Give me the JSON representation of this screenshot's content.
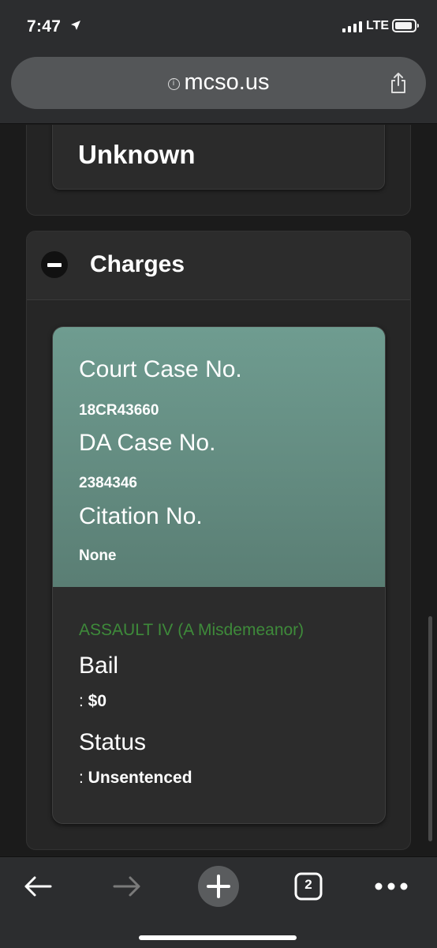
{
  "status_bar": {
    "time": "7:47",
    "network": "LTE"
  },
  "browser": {
    "url": "mcso.us",
    "tab_count": "2"
  },
  "previous_section": {
    "value": "Unknown"
  },
  "charges_section": {
    "title": "Charges",
    "charge": {
      "court_case_label": "Court Case No.",
      "court_case_value": "18CR43660",
      "da_case_label": "DA Case No.",
      "da_case_value": "2384346",
      "citation_label": "Citation No.",
      "citation_value": "None",
      "offense": "ASSAULT IV (A Misdemeanor)",
      "bail_label": "Bail",
      "bail_prefix": ": ",
      "bail_value": "$0",
      "status_label": "Status",
      "status_prefix": ": ",
      "status_value": "Unsentenced"
    }
  },
  "colors": {
    "card_header": "#6f9c90",
    "offense_text": "#3e8a3a",
    "chrome": "#2c2d2f"
  },
  "icons": [
    "location-arrow-icon",
    "signal-icon",
    "battery-icon",
    "info-icon",
    "share-icon",
    "back-icon",
    "forward-icon",
    "new-tab-icon",
    "tabs-icon",
    "more-icon"
  ]
}
